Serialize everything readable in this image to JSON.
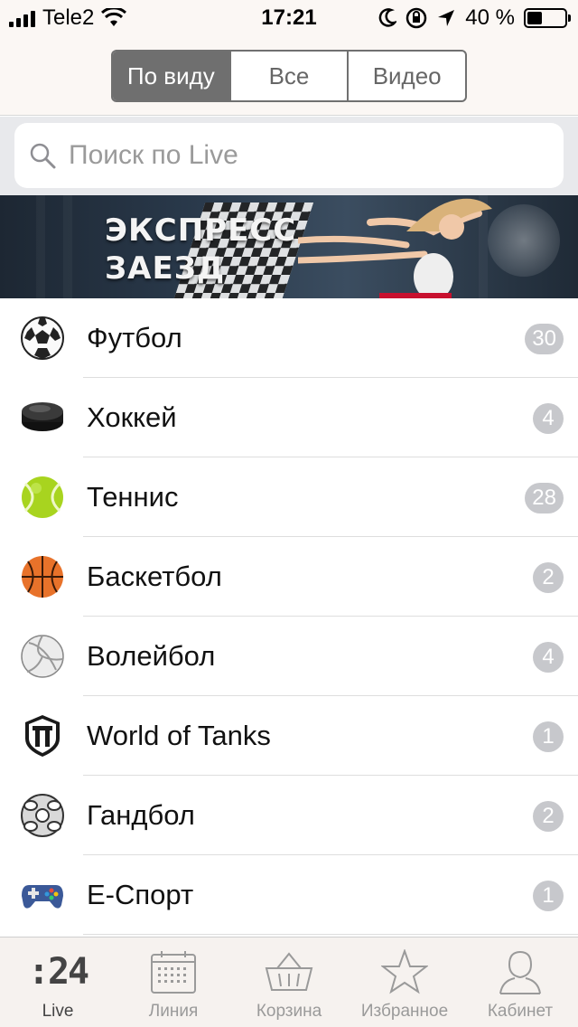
{
  "status_bar": {
    "carrier": "Tele2",
    "time": "17:21",
    "battery_percent": "40 %",
    "battery_level": 0.4
  },
  "segments": {
    "items": [
      {
        "label": "По виду",
        "active": true
      },
      {
        "label": "Все",
        "active": false
      },
      {
        "label": "Видео",
        "active": false
      }
    ]
  },
  "search": {
    "placeholder": "Поиск по Live"
  },
  "banner": {
    "line1": "ЭКСПРЕСС",
    "line2": "ЗАЕЗД"
  },
  "sports": [
    {
      "name": "Футбол",
      "count": "30",
      "icon": "soccer-ball-icon"
    },
    {
      "name": "Хоккей",
      "count": "4",
      "icon": "hockey-puck-icon"
    },
    {
      "name": "Теннис",
      "count": "28",
      "icon": "tennis-ball-icon"
    },
    {
      "name": "Баскетбол",
      "count": "2",
      "icon": "basketball-icon"
    },
    {
      "name": "Волейбол",
      "count": "4",
      "icon": "volleyball-icon"
    },
    {
      "name": "World of Tanks",
      "count": "1",
      "icon": "world-of-tanks-icon"
    },
    {
      "name": "Гандбол",
      "count": "2",
      "icon": "handball-icon"
    },
    {
      "name": "Е-Спорт",
      "count": "1",
      "icon": "gamepad-icon"
    }
  ],
  "tabs": {
    "live": {
      "label": "Live",
      "icon_text": ":24"
    },
    "line": {
      "label": "Линия"
    },
    "cart": {
      "label": "Корзина"
    },
    "favorites": {
      "label": "Избранное"
    },
    "cabinet": {
      "label": "Кабинет"
    }
  },
  "colors": {
    "badge": "#c7c8cc",
    "segment_active": "#6f6f6f",
    "header_bg": "#fbf7f4"
  }
}
